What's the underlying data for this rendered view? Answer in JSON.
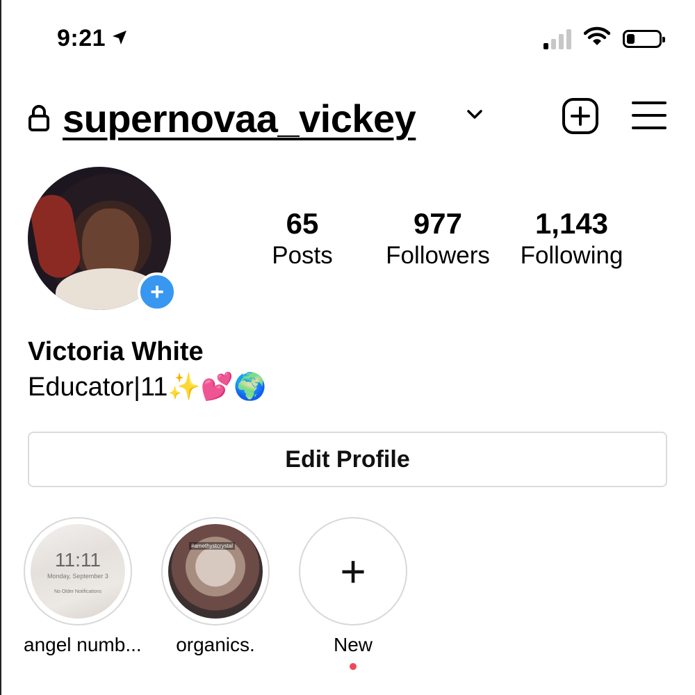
{
  "status_bar": {
    "time": "9:21",
    "location_icon": "location-arrow-icon",
    "signal_icon": "cellular-signal-icon",
    "wifi_icon": "wifi-icon",
    "battery_icon": "battery-icon",
    "battery_level": 0.25
  },
  "header": {
    "lock_icon": "lock-icon",
    "username": "supernovaa_vickey",
    "switch_icon": "chevron-down-icon",
    "add_icon": "plus-square-icon",
    "menu_icon": "hamburger-menu-icon"
  },
  "profile": {
    "avatar_add_symbol": "+",
    "stats": {
      "posts": {
        "value": "65",
        "label": "Posts"
      },
      "followers": {
        "value": "977",
        "label": "Followers"
      },
      "following": {
        "value": "1,143",
        "label": "Following"
      }
    },
    "full_name": "Victoria White",
    "bio": "Educator|11✨💕🌍"
  },
  "edit_profile_label": "Edit Profile",
  "highlights": [
    {
      "label": "angel numb...",
      "cover_time": "11:11",
      "cover_date": "Monday, September 3",
      "cover_note": "No Older Notifications"
    },
    {
      "label": "organics.",
      "cover_tag": "#amethystcrystal"
    },
    {
      "label": "New",
      "symbol": "+"
    }
  ],
  "colors": {
    "accent_blue": "#3897f0",
    "notification_red": "#ed4956",
    "border_gray": "#dbdbdb"
  }
}
